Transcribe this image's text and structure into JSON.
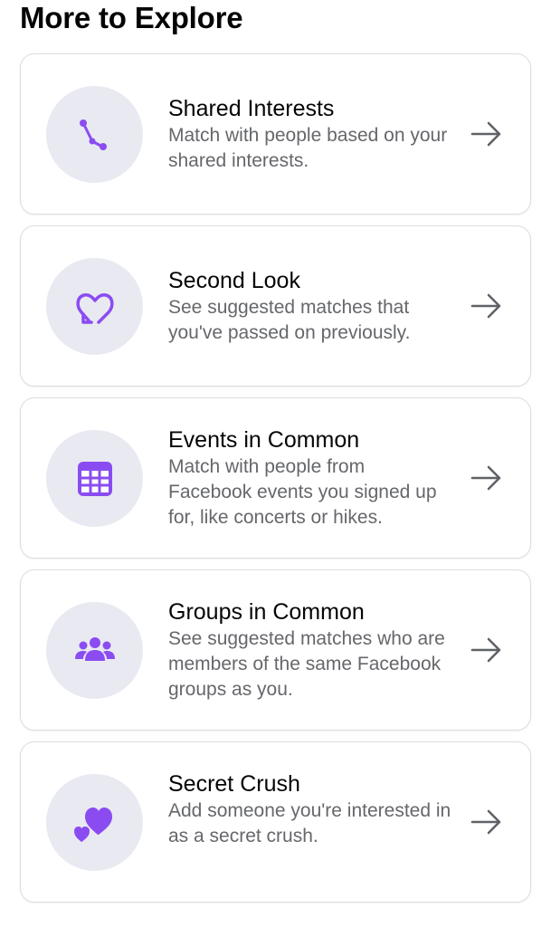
{
  "page": {
    "title": "More to Explore"
  },
  "colors": {
    "accent": "#8a4cf1",
    "icon_bg": "#e9e9f1",
    "description": "#65676b",
    "arrow": "#5f6368"
  },
  "cards": [
    {
      "title": "Shared Interests",
      "description": "Match with people based on your shared interests.",
      "icon": "shared-interests-icon"
    },
    {
      "title": "Second Look",
      "description": "See suggested matches that you've passed on previously.",
      "icon": "heart-replay-icon"
    },
    {
      "title": "Events in Common",
      "description": "Match with people from Facebook events you signed up for, like concerts or hikes.",
      "icon": "calendar-icon"
    },
    {
      "title": "Groups in Common",
      "description": "See suggested matches who are members of the same Facebook groups as you.",
      "icon": "group-icon"
    },
    {
      "title": "Secret Crush",
      "description": "Add someone you're interested in as a secret crush.",
      "icon": "hearts-icon"
    }
  ]
}
